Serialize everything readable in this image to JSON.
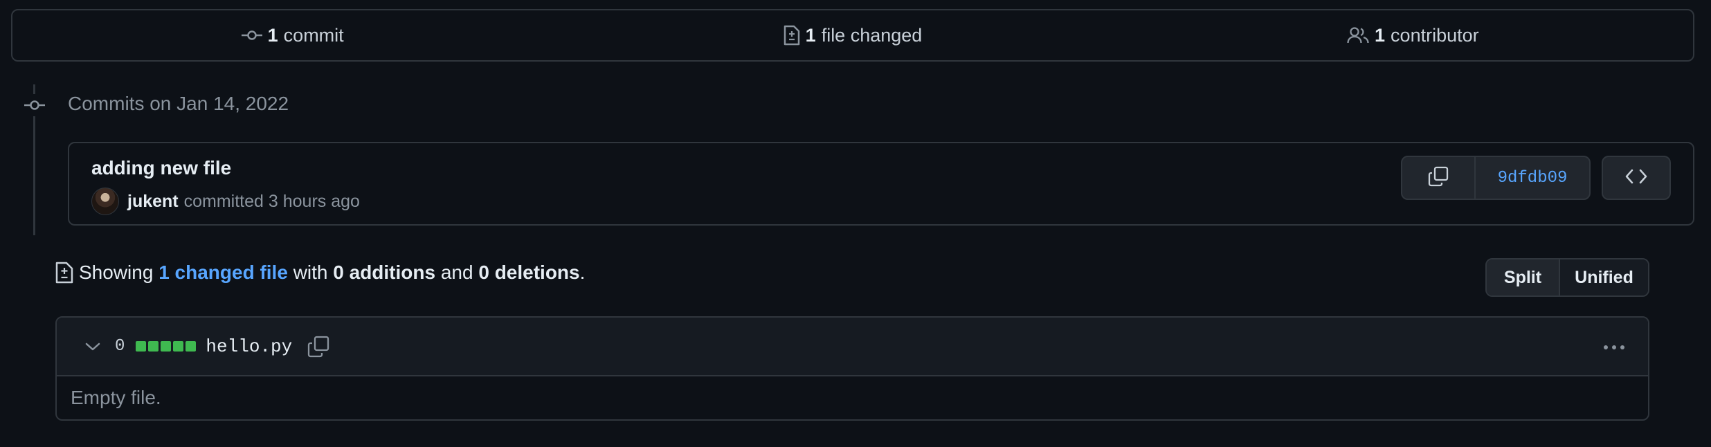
{
  "summary": {
    "commits": {
      "count": "1",
      "label": "commit",
      "icon": "git-commit-icon"
    },
    "files": {
      "count": "1",
      "label": "file changed",
      "icon": "file-diff-icon"
    },
    "contributors": {
      "count": "1",
      "label": "contributor",
      "icon": "people-icon"
    }
  },
  "timeline": {
    "heading": "Commits on Jan 14, 2022"
  },
  "commit": {
    "title": "adding new file",
    "author": "jukent",
    "meta": "committed 3 hours ago",
    "sha": "9dfdb09",
    "copy_icon": "copy-icon",
    "browse_icon": "code-icon"
  },
  "diff_summary": {
    "prefix": "Showing",
    "changed_link": "1 changed file",
    "with": "with",
    "additions": "0 additions",
    "and": "and",
    "deletions": "0 deletions",
    "suffix": "."
  },
  "view_toggle": {
    "split": "Split",
    "unified": "Unified",
    "selected": "Split"
  },
  "file": {
    "change_count": "0",
    "filename": "hello.py",
    "body": "Empty file.",
    "diffstat_color": "#3fb950"
  },
  "colors": {
    "background": "#0d1117",
    "border": "#30363d",
    "link": "#58a6ff",
    "muted": "#8b949e"
  }
}
